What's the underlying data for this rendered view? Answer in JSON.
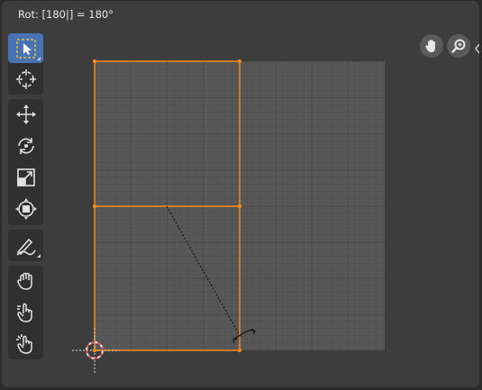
{
  "header": {
    "operator_readout": "Rot: [180|] = 180°"
  },
  "toolbar": {
    "tools": [
      {
        "id": "select-box",
        "icon": "select-box-icon",
        "active": true
      },
      {
        "id": "cursor",
        "icon": "cursor-icon",
        "active": false
      },
      {
        "id": "move",
        "icon": "move-icon",
        "active": false
      },
      {
        "id": "rotate",
        "icon": "rotate-icon",
        "active": false
      },
      {
        "id": "scale",
        "icon": "scale-icon",
        "active": false
      },
      {
        "id": "transform",
        "icon": "transform-icon",
        "active": false
      },
      {
        "id": "annotate",
        "icon": "annotate-icon",
        "active": false
      },
      {
        "id": "grab",
        "icon": "grab-hand-icon",
        "active": false
      },
      {
        "id": "relax",
        "icon": "relax-hand-icon",
        "active": false
      },
      {
        "id": "pinch",
        "icon": "pinch-hand-icon",
        "active": false
      }
    ]
  },
  "navigation": {
    "pan_icon": "hand-pan-icon",
    "zoom_icon": "zoom-icon",
    "sidebar_icon": "chevron-left-icon"
  },
  "colors": {
    "editor_bg": "#3d3d3d",
    "grid_bg": "#575757",
    "selection": "#ff8c1a",
    "active_tool": "#4772b3"
  }
}
